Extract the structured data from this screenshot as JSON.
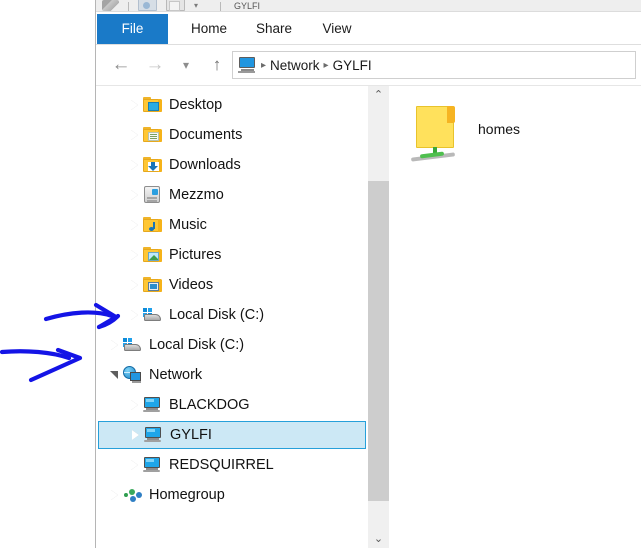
{
  "window": {
    "quick_access": {
      "icons": [
        "plug-icon",
        "properties-icon",
        "new-folder-icon",
        "customize-chevron-icon"
      ],
      "title": "GYLFI"
    },
    "ribbon_tabs": [
      {
        "label": "File",
        "active": true
      },
      {
        "label": "Home",
        "active": false
      },
      {
        "label": "Share",
        "active": false
      },
      {
        "label": "View",
        "active": false
      }
    ],
    "address_bar": {
      "back_icon": "arrow-left-icon",
      "forward_icon": "arrow-right-icon",
      "recent_icon": "chevron-down-icon",
      "up_icon": "arrow-up-icon",
      "location_icon": "computer-icon",
      "crumbs": [
        "Network",
        "GYLFI"
      ],
      "separator": "▸"
    }
  },
  "nav_pane": {
    "items": [
      {
        "label": "Desktop",
        "icon": "folder-desktop-icon",
        "indent": 2,
        "expander": "collapsed",
        "selected": false
      },
      {
        "label": "Documents",
        "icon": "folder-documents-icon",
        "indent": 2,
        "expander": "collapsed",
        "selected": false
      },
      {
        "label": "Downloads",
        "icon": "folder-downloads-icon",
        "indent": 2,
        "expander": "collapsed",
        "selected": false
      },
      {
        "label": "Mezzmo",
        "icon": "device-mezzmo-icon",
        "indent": 2,
        "expander": "collapsed",
        "selected": false
      },
      {
        "label": "Music",
        "icon": "folder-music-icon",
        "indent": 2,
        "expander": "collapsed",
        "selected": false
      },
      {
        "label": "Pictures",
        "icon": "folder-pictures-icon",
        "indent": 2,
        "expander": "collapsed",
        "selected": false
      },
      {
        "label": "Videos",
        "icon": "folder-videos-icon",
        "indent": 2,
        "expander": "collapsed",
        "selected": false
      },
      {
        "label": "Local Disk (C:)",
        "icon": "hard-disk-icon",
        "indent": 2,
        "expander": "collapsed",
        "selected": false
      },
      {
        "label": "Local Disk (C:)",
        "icon": "hard-disk-icon",
        "indent": 1,
        "expander": "collapsed",
        "selected": false
      },
      {
        "label": "Network",
        "icon": "network-icon",
        "indent": 1,
        "expander": "expanded",
        "selected": false
      },
      {
        "label": "BLACKDOG",
        "icon": "computer-icon",
        "indent": 2,
        "expander": "collapsed",
        "selected": false
      },
      {
        "label": "GYLFI",
        "icon": "computer-icon",
        "indent": 2,
        "expander": "collapsed",
        "selected": true
      },
      {
        "label": "REDSQUIRREL",
        "icon": "computer-icon",
        "indent": 2,
        "expander": "collapsed",
        "selected": false
      },
      {
        "label": "Homegroup",
        "icon": "homegroup-icon",
        "indent": 1,
        "expander": "collapsed",
        "selected": false
      }
    ],
    "scrollbar": {
      "up_arrow": "⌃",
      "down_arrow": "⌄"
    }
  },
  "content_pane": {
    "files": [
      {
        "name": "homes",
        "icon": "shared-network-folder-icon"
      }
    ]
  },
  "annotations": {
    "color": "#1414e6",
    "arrows": [
      {
        "name": "arrow-pointing-to-local-disk-nested",
        "target": "Local Disk (C:) nested under user folders"
      },
      {
        "name": "arrow-pointing-to-local-disk-root",
        "target": "Local Disk (C:) at root level"
      }
    ]
  },
  "colors": {
    "file_tab_blue": "#1a7ac8",
    "selection_fill": "#cce8f5",
    "selection_border": "#26a0da",
    "scrollbar_thumb": "#cdcdcd",
    "annotation_blue": "#1414e6"
  }
}
